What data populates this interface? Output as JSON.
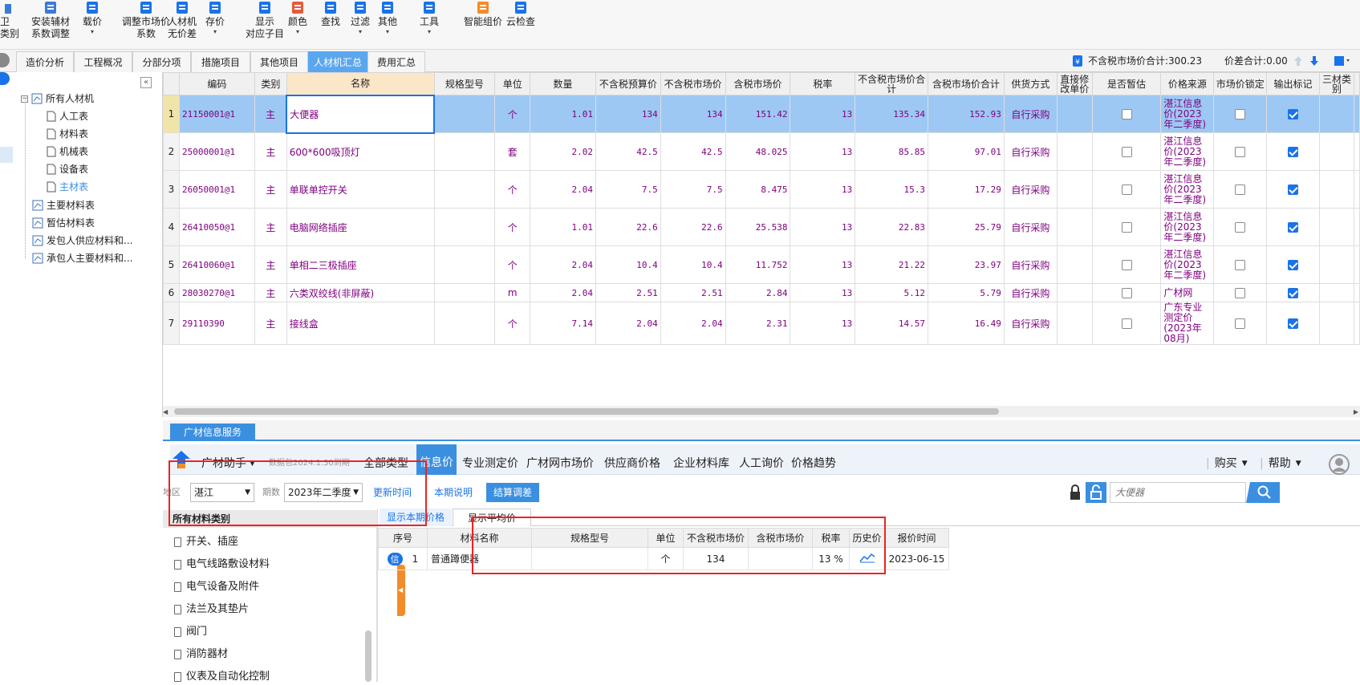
{
  "toolbar": {
    "partial_left_1": "卫",
    "partial_left_2": "类别",
    "items": [
      {
        "line1": "安装辅材",
        "line2": "系数调整"
      },
      {
        "line1": "载价",
        "line2": "▾"
      },
      {
        "line1": "调整市场价",
        "line2": "系数"
      },
      {
        "line1": "人材机",
        "line2": "无价差"
      },
      {
        "line1": "存价",
        "line2": "▾"
      },
      {
        "line1": "显示",
        "line2": "对应子目"
      },
      {
        "line1": "颜色",
        "line2": "▾"
      },
      {
        "line1": "查找",
        "line2": ""
      },
      {
        "line1": "过滤",
        "line2": "▾"
      },
      {
        "line1": "其他",
        "line2": "▾"
      },
      {
        "line1": "工具",
        "line2": "▾"
      },
      {
        "line1": "智能组价",
        "line2": ""
      },
      {
        "line1": "云检查",
        "line2": ""
      }
    ]
  },
  "tabs": [
    "造价分析",
    "工程概况",
    "分部分项",
    "措施项目",
    "其他项目",
    "人材机汇总",
    "费用汇总"
  ],
  "summary": {
    "market_total_label": "不含税市场价合计:300.23",
    "diff_total_label": "价差合计:0.00"
  },
  "tree": {
    "root": "所有人材机",
    "children": [
      "人工表",
      "材料表",
      "机械表",
      "设备表",
      "主材表"
    ],
    "others": [
      "主要材料表",
      "暂估材料表",
      "发包人供应材料和...",
      "承包人主要材料和..."
    ]
  },
  "grid": {
    "headers": [
      "编码",
      "类别",
      "名称",
      "规格型号",
      "单位",
      "数量",
      "不含税预算价",
      "不含税市场价",
      "含税市场价",
      "税率",
      "不含税市场价合计",
      "含税市场价合计",
      "供货方式",
      "直接修改单价",
      "是否暂估",
      "价格来源",
      "市场价锁定",
      "输出标记",
      "三材类别"
    ],
    "rows": [
      {
        "no": "1",
        "code": "21150001@1",
        "type": "主",
        "name": "大便器",
        "spec": "",
        "unit": "个",
        "qty": "1.01",
        "budget": "134",
        "market": "134",
        "tax_market": "151.42",
        "rate": "13",
        "total": "135.34",
        "tax_total": "152.93",
        "supply": "自行采购",
        "est": false,
        "source": "湛江信息价(2023年二季度)",
        "lock": false,
        "out": true
      },
      {
        "no": "2",
        "code": "25000001@1",
        "type": "主",
        "name": "600*600吸顶灯",
        "spec": "",
        "unit": "套",
        "qty": "2.02",
        "budget": "42.5",
        "market": "42.5",
        "tax_market": "48.025",
        "rate": "13",
        "total": "85.85",
        "tax_total": "97.01",
        "supply": "自行采购",
        "est": false,
        "source": "湛江信息价(2023年二季度)",
        "lock": false,
        "out": true
      },
      {
        "no": "3",
        "code": "26050001@1",
        "type": "主",
        "name": "单联单控开关",
        "spec": "",
        "unit": "个",
        "qty": "2.04",
        "budget": "7.5",
        "market": "7.5",
        "tax_market": "8.475",
        "rate": "13",
        "total": "15.3",
        "tax_total": "17.29",
        "supply": "自行采购",
        "est": false,
        "source": "湛江信息价(2023年二季度)",
        "lock": false,
        "out": true
      },
      {
        "no": "4",
        "code": "26410050@1",
        "type": "主",
        "name": "电脑网络插座",
        "spec": "",
        "unit": "个",
        "qty": "1.01",
        "budget": "22.6",
        "market": "22.6",
        "tax_market": "25.538",
        "rate": "13",
        "total": "22.83",
        "tax_total": "25.79",
        "supply": "自行采购",
        "est": false,
        "source": "湛江信息价(2023年二季度)",
        "lock": false,
        "out": true
      },
      {
        "no": "5",
        "code": "26410060@1",
        "type": "主",
        "name": "单相二三极插座",
        "spec": "",
        "unit": "个",
        "qty": "2.04",
        "budget": "10.4",
        "market": "10.4",
        "tax_market": "11.752",
        "rate": "13",
        "total": "21.22",
        "tax_total": "23.97",
        "supply": "自行采购",
        "est": false,
        "source": "湛江信息价(2023年二季度)",
        "lock": false,
        "out": true
      },
      {
        "no": "6",
        "code": "28030270@1",
        "type": "主",
        "name": "六类双绞线(非屏蔽)",
        "spec": "",
        "unit": "m",
        "qty": "2.04",
        "budget": "2.51",
        "market": "2.51",
        "tax_market": "2.84",
        "rate": "13",
        "total": "5.12",
        "tax_total": "5.79",
        "supply": "自行采购",
        "est": false,
        "source": "广材网",
        "lock": false,
        "out": true
      },
      {
        "no": "7",
        "code": "29110390",
        "type": "主",
        "name": "接线盒",
        "spec": "",
        "unit": "个",
        "qty": "7.14",
        "budget": "2.04",
        "market": "2.04",
        "tax_market": "2.31",
        "rate": "13",
        "total": "14.57",
        "tax_total": "16.49",
        "supply": "自行采购",
        "est": false,
        "source": "广东专业测定价(2023年08月)",
        "lock": false,
        "out": true
      }
    ]
  },
  "service": {
    "panel_tab": "广材信息服务",
    "assistant": "广材助手",
    "data_date": "数据包2024.1.30到期",
    "nav": [
      "全部类型",
      "信息价",
      "专业测定价",
      "广材网市场价",
      "供应商价格",
      "企业材料库",
      "人工询价",
      "价格趋势"
    ],
    "buy": "购买",
    "help": "帮助",
    "region_label": "地区",
    "region_value": "湛江",
    "period_label": "期数",
    "period_value": "2023年二季度",
    "update_time": "更新时间",
    "period_note": "本期说明",
    "settle_btn": "结算调差",
    "search_placeholder": "大便器",
    "category_header": "所有材料类别",
    "categories": [
      "开关、插座",
      "电气线路敷设材料",
      "电气设备及附件",
      "法兰及其垫片",
      "阀门",
      "消防器材",
      "仪表及自动化控制"
    ],
    "price_tabs": [
      "显示本期价格",
      "显示平均价"
    ],
    "price_headers": [
      "序号",
      "材料名称",
      "规格型号",
      "单位",
      "不含税市场价",
      "含税市场价",
      "税率",
      "历史价",
      "报价时间"
    ],
    "price_rows": [
      {
        "badge": "信",
        "no": "1",
        "name": "普通蹲便器",
        "spec": "",
        "unit": "个",
        "market": "134",
        "tax_market": "",
        "rate": "13 %",
        "date": "2023-06-15"
      }
    ]
  }
}
